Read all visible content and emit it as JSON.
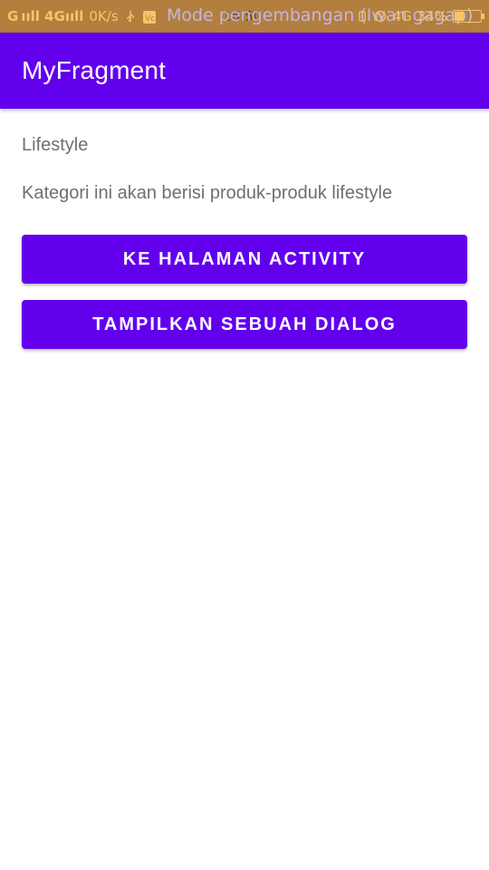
{
  "status_bar": {
    "signal_left": "G ııll 4Gııll",
    "net_speed": "0K/s",
    "usb_icon": "usb-icon",
    "time": "16:50",
    "overlay_text": "Mode pengembangan (Iwan gagap)",
    "signal_right": "4G",
    "battery": "34%",
    "battery_level": 0.34,
    "colors": {
      "background": "#b27f3e",
      "text": "#f7c46a"
    }
  },
  "app_bar": {
    "title": "MyFragment",
    "color": "#6200ee"
  },
  "content": {
    "category_name": "Lifestyle",
    "category_description": "Kategori ini akan berisi produk-produk lifestyle"
  },
  "buttons": {
    "to_activity": "KE HALAMAN ACTIVITY",
    "show_dialog": "TAMPILKAN SEBUAH DIALOG",
    "color": "#6200ee"
  }
}
